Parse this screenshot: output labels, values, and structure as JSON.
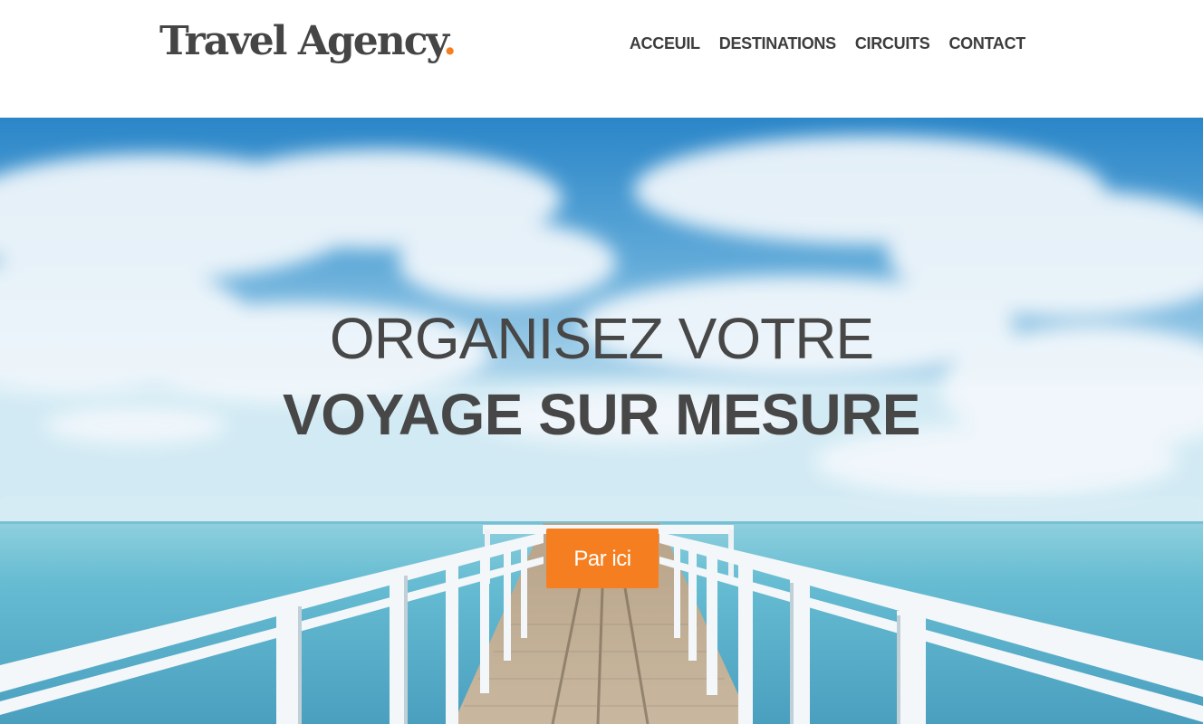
{
  "header": {
    "logo_text": "Travel Agency",
    "logo_dot": ".",
    "nav": [
      {
        "label": "ACCEUIL"
      },
      {
        "label": "DESTINATIONS"
      },
      {
        "label": "CIRCUITS"
      },
      {
        "label": "CONTACT"
      }
    ]
  },
  "hero": {
    "line1": "ORGANISEZ VOTRE",
    "line2": "VOYAGE SUR MESURE",
    "cta_label": "Par ici",
    "background": "pier-over-sea-photo"
  },
  "colors": {
    "accent": "#f57f20",
    "text_dark": "#454545"
  }
}
